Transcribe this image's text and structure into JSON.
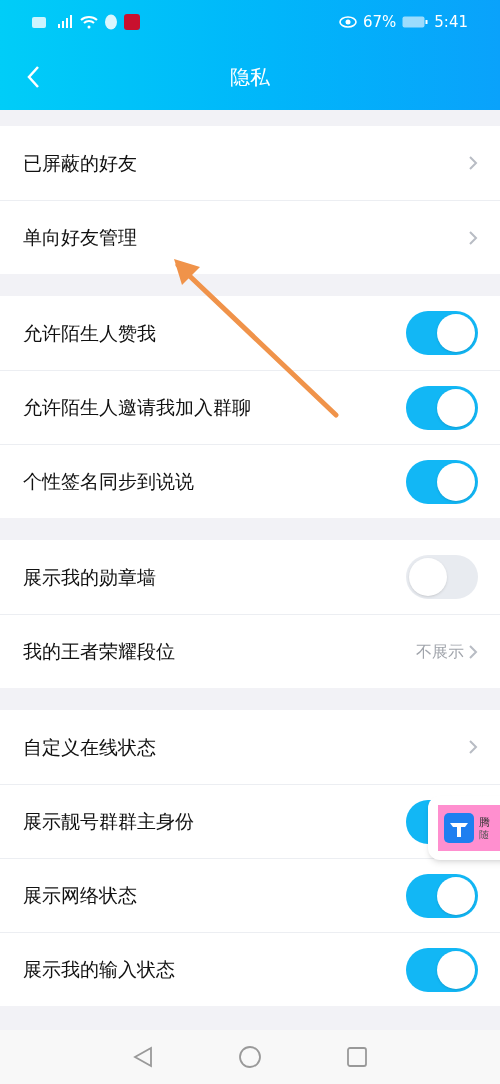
{
  "status_bar": {
    "battery": "67%",
    "time": "5:41"
  },
  "header": {
    "title": "隐私"
  },
  "sections": [
    [
      {
        "label": "已屏蔽的好友",
        "kind": "link"
      },
      {
        "label": "单向好友管理",
        "kind": "link"
      }
    ],
    [
      {
        "label": "允许陌生人赞我",
        "kind": "toggle",
        "on": true
      },
      {
        "label": "允许陌生人邀请我加入群聊",
        "kind": "toggle",
        "on": true
      },
      {
        "label": "个性签名同步到说说",
        "kind": "toggle",
        "on": true
      }
    ],
    [
      {
        "label": "展示我的勋章墙",
        "kind": "toggle",
        "on": false
      },
      {
        "label": "我的王者荣耀段位",
        "kind": "link",
        "value": "不展示"
      }
    ],
    [
      {
        "label": "自定义在线状态",
        "kind": "link"
      },
      {
        "label": "展示靓号群群主身份",
        "kind": "toggle",
        "on": true
      },
      {
        "label": "展示网络状态",
        "kind": "toggle",
        "on": true
      },
      {
        "label": "展示我的输入状态",
        "kind": "toggle",
        "on": true
      }
    ]
  ],
  "floating_card": {
    "title": "腾",
    "subtitle": "随"
  }
}
